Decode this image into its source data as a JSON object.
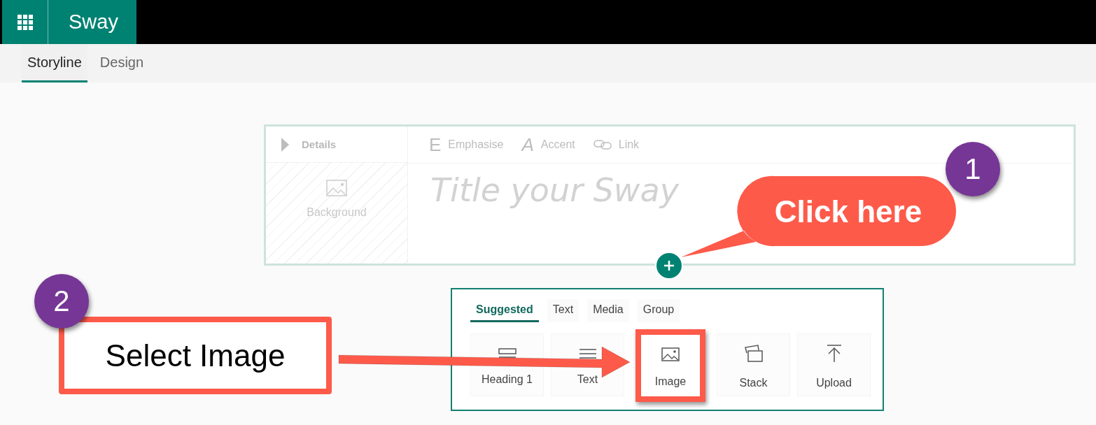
{
  "app": {
    "name": "Sway"
  },
  "tabs": [
    {
      "label": "Storyline",
      "selected": true
    },
    {
      "label": "Design",
      "selected": false
    }
  ],
  "title_card": {
    "details_label": "Details",
    "background_label": "Background",
    "title_placeholder": "Title your Sway",
    "toolbar": [
      {
        "kind": "glyph",
        "glyph": "E",
        "label": "Emphasise"
      },
      {
        "kind": "glyph",
        "glyph": "A",
        "label": "Accent"
      },
      {
        "kind": "link",
        "label": "Link"
      }
    ]
  },
  "insert_panel": {
    "tabs": [
      {
        "label": "Suggested",
        "selected": true
      },
      {
        "label": "Text",
        "selected": false
      },
      {
        "label": "Media",
        "selected": false
      },
      {
        "label": "Group",
        "selected": false
      }
    ],
    "items": [
      {
        "kind": "heading",
        "label": "Heading 1",
        "highlighted": false
      },
      {
        "kind": "text",
        "label": "Text",
        "highlighted": false
      },
      {
        "kind": "image",
        "label": "Image",
        "highlighted": true
      },
      {
        "kind": "stack",
        "label": "Stack",
        "highlighted": false
      },
      {
        "kind": "upload",
        "label": "Upload",
        "highlighted": false
      }
    ]
  },
  "annotations": {
    "callout": {
      "step": "1",
      "text": "Click here"
    },
    "instruction": {
      "step": "2",
      "text": "Select Image"
    }
  }
}
